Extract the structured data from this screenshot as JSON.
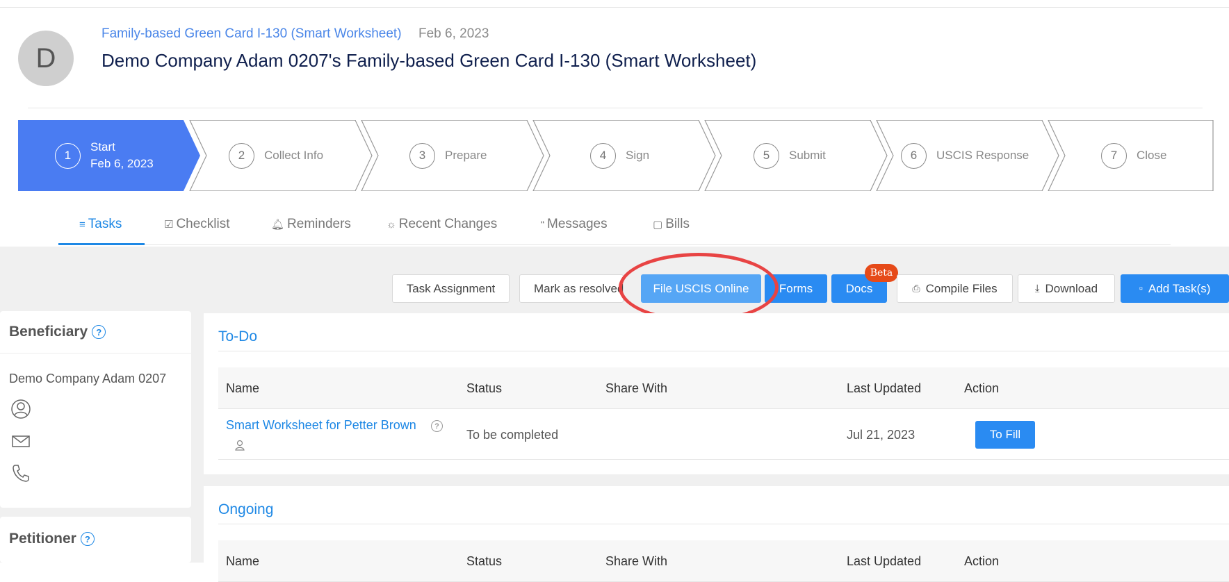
{
  "header": {
    "avatar_letter": "D",
    "case_type_link": "Family-based Green Card I-130 (Smart Worksheet)",
    "case_date": "Feb 6, 2023",
    "case_title": "Demo Company Adam 0207's Family-based Green Card I-130 (Smart Worksheet)"
  },
  "steps": [
    {
      "number": "1",
      "label": "Start",
      "sublabel": "Feb 6, 2023",
      "active": true
    },
    {
      "number": "2",
      "label": "Collect Info"
    },
    {
      "number": "3",
      "label": "Prepare"
    },
    {
      "number": "4",
      "label": "Sign"
    },
    {
      "number": "5",
      "label": "Submit"
    },
    {
      "number": "6",
      "label": "USCIS Response"
    },
    {
      "number": "7",
      "label": "Close"
    }
  ],
  "tabs": [
    {
      "label": "Tasks",
      "icon": "list-icon",
      "active": true
    },
    {
      "label": "Checklist",
      "icon": "checkbox-icon"
    },
    {
      "label": "Reminders",
      "icon": "bell-icon"
    },
    {
      "label": "Recent Changes",
      "icon": "bulb-icon"
    },
    {
      "label": "Messages",
      "icon": "quote-icon"
    },
    {
      "label": "Bills",
      "icon": "box-icon"
    }
  ],
  "toolbar": {
    "task_assignment": "Task Assignment",
    "mark_resolved": "Mark as resolved",
    "file_uscis": "File USCIS Online",
    "forms": "Forms",
    "docs": "Docs",
    "beta_badge": "Beta",
    "compile_files": "Compile Files",
    "download": "Download",
    "add_tasks": "Add Task(s)"
  },
  "beneficiary": {
    "title": "Beneficiary",
    "name": "Demo Company Adam 0207"
  },
  "petitioner": {
    "title": "Petitioner"
  },
  "todo": {
    "title": "To-Do",
    "columns": [
      "Name",
      "Status",
      "Share With",
      "Last Updated",
      "Action"
    ],
    "rows": [
      {
        "name": "Smart Worksheet for Petter Brown",
        "status": "To be completed",
        "share_with": "",
        "last_updated": "Jul 21, 2023",
        "action": "To Fill"
      }
    ]
  },
  "ongoing": {
    "title": "Ongoing",
    "columns": [
      "Name",
      "Status",
      "Share With",
      "Last Updated",
      "Action"
    ]
  },
  "colors": {
    "accent": "#1e88e5",
    "active_step": "#4a7cf2",
    "annotation": "#e84444"
  }
}
